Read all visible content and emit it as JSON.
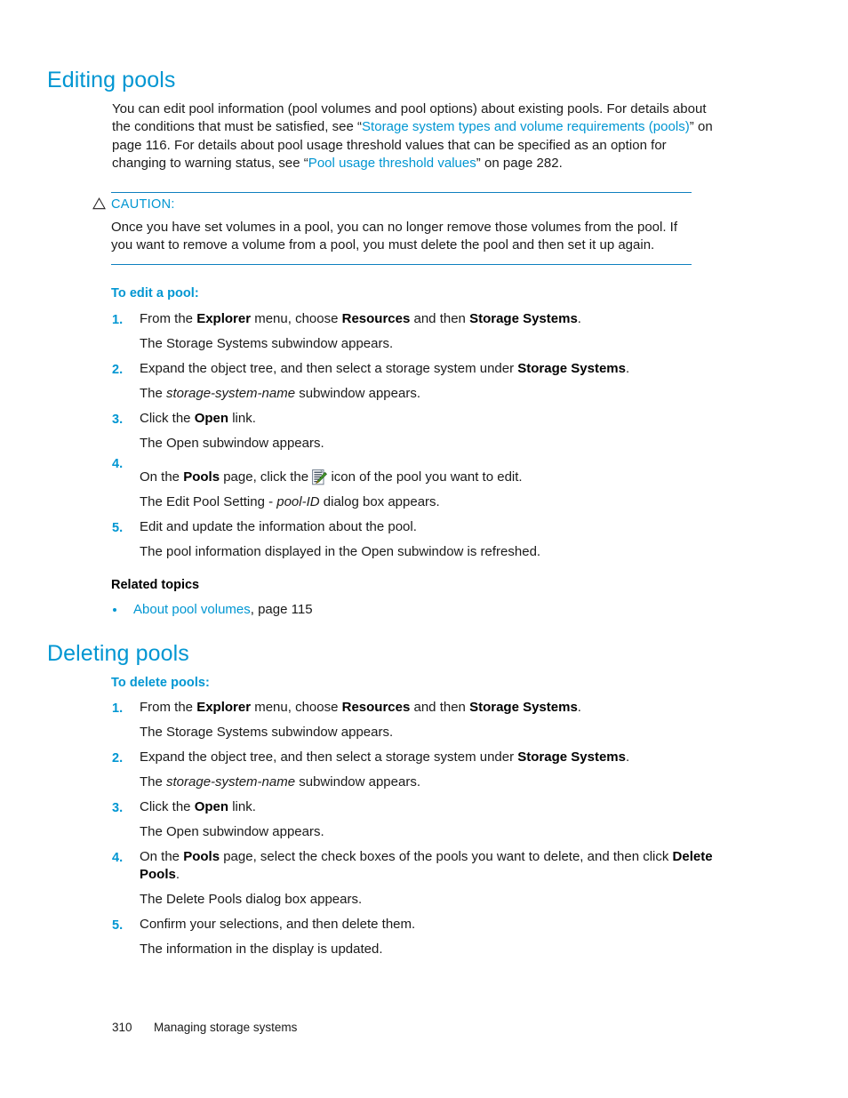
{
  "colors": {
    "heading_blue": "#0096d2",
    "rule_blue": "#0e80bf",
    "body_text": "#1a1a1a",
    "link_blue": "#0096d2"
  },
  "sections": {
    "editing": {
      "title": "Editing pools",
      "intro_pre": "You can edit pool information (pool volumes and pool options) about existing pools. For details about the conditions that must be satisfied, see “",
      "intro_link1": "Storage system types and volume requirements (pools)",
      "intro_mid": "” on page 116. For details about pool usage threshold values that can be specified as an option for changing to warning status, see “",
      "intro_link2": "Pool usage threshold values",
      "intro_post": "” on page 282.",
      "caution": {
        "label": "CAUTION:",
        "icon": "warning-triangle-icon",
        "body": "Once you have set volumes in a pool, you can no longer remove those volumes from the pool. If you want to remove a volume from a pool, you must delete the pool and then set it up again."
      },
      "procedure_head": "To edit a pool:",
      "steps": [
        {
          "num": "1.",
          "text_parts": [
            "From the ",
            "Explorer",
            " menu, choose ",
            "Resources",
            " and then ",
            "Storage Systems",
            "."
          ],
          "result": "The Storage Systems subwindow appears."
        },
        {
          "num": "2.",
          "text_parts": [
            "Expand the object tree, and then select a storage system under ",
            "Storage Systems",
            "."
          ],
          "result_pre": "The ",
          "result_italic": "storage-system-name",
          "result_post": " subwindow appears."
        },
        {
          "num": "3.",
          "text_parts": [
            "Click the ",
            "Open",
            " link."
          ],
          "result": "The Open subwindow appears."
        },
        {
          "num": "4.",
          "text_pre": "On the ",
          "text_bold": "Pools",
          "text_mid": " page, click the ",
          "icon": "edit-pool-icon",
          "text_post": " icon of the pool you want to edit.",
          "result_pre": "The Edit Pool Setting - ",
          "result_italic": "pool-ID",
          "result_post": " dialog box appears."
        },
        {
          "num": "5.",
          "text": "Edit and update the information about the pool.",
          "result": "The pool information displayed in the Open subwindow is refreshed."
        }
      ],
      "related_head": "Related topics",
      "related_items": [
        {
          "link": "About pool volumes",
          "suffix": ", page 115"
        }
      ]
    },
    "deleting": {
      "title": "Deleting pools",
      "procedure_head": "To delete pools:",
      "steps": [
        {
          "num": "1.",
          "text_parts": [
            "From the ",
            "Explorer",
            " menu, choose ",
            "Resources",
            " and then ",
            "Storage Systems",
            "."
          ],
          "result": "The Storage Systems subwindow appears."
        },
        {
          "num": "2.",
          "text_parts": [
            "Expand the object tree, and then select a storage system under ",
            "Storage Systems",
            "."
          ],
          "result_pre": "The ",
          "result_italic": "storage-system-name",
          "result_post": " subwindow appears."
        },
        {
          "num": "3.",
          "text_parts": [
            "Click the ",
            "Open",
            " link."
          ],
          "result": "The Open subwindow appears."
        },
        {
          "num": "4.",
          "text_pre": "On the ",
          "text_bold": "Pools",
          "text_mid": " page, select the check boxes of the pools you want to delete, and then click ",
          "text_bold2": "Delete Pools",
          "text_post": ".",
          "result": "The Delete Pools dialog box appears."
        },
        {
          "num": "5.",
          "text": "Confirm your selections, and then delete them.",
          "result": "The information in the display is updated."
        }
      ]
    }
  },
  "footer": {
    "page_number": "310",
    "chapter": "Managing storage systems"
  }
}
